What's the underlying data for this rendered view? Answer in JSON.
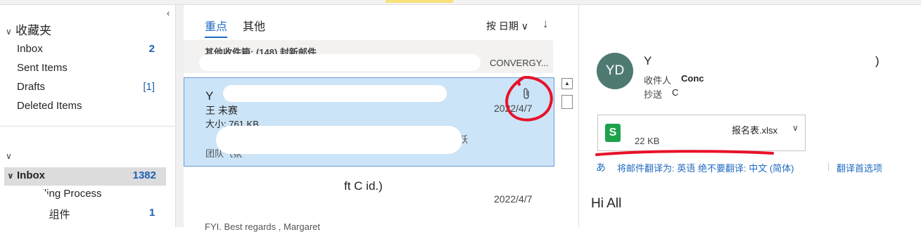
{
  "nav": {
    "collapse_glyph": "‹",
    "favorites_label": "收藏夹",
    "favorites": [
      {
        "label": "Inbox",
        "count": "2"
      },
      {
        "label": "Sent Items",
        "count": ""
      },
      {
        "label": "Drafts",
        "count": "[1]"
      },
      {
        "label": "Deleted Items",
        "count": ""
      }
    ],
    "inbox_label": "Inbox",
    "inbox_count": "1382",
    "subfolders": [
      {
        "label": "e H  lling Process",
        "count": ""
      },
      {
        "label": "i   立圾组件",
        "count": "1"
      }
    ]
  },
  "list": {
    "tabs": [
      "重点",
      "其他"
    ],
    "sort_label": "按 日期 ∨",
    "sort_arrow": "↓",
    "group_header": "其他收件箱: (148) 封新邮件",
    "group_sub": "CONVERGY...",
    "selected": {
      "sender": "Y",
      "subject": "王   未赛",
      "size": "大小: 761 KB",
      "date": "2022/4/7",
      "preview1": "跃",
      "preview2": "团队气氛"
    },
    "second": {
      "subject": "ft C   id.)",
      "date": "2022/4/7",
      "preview": "FYI. Best regards , Margaret"
    }
  },
  "reading": {
    "avatar_initials": "YD",
    "from": "Y",
    "from_close": ")",
    "to_label": "收件人",
    "to_value": "Conc",
    "cc_label": "抄送",
    "cc_value": "C",
    "attachment_name": "报名表.xlsx",
    "attachment_size": "22 KB",
    "attachment_icon": "excel-icon",
    "translate_link": "将邮件翻译为: 英语",
    "never_translate": "绝不要翻译: 中文 (简体)",
    "translate_prefs": "翻译首选项",
    "body": "Hi All"
  },
  "colors": {
    "accent": "#1f6ac2",
    "count_blue": "#1f5fb4",
    "selected_bg": "#cce4f7",
    "avatar_bg": "#4e7a72",
    "annotation_red": "#e8122a"
  }
}
